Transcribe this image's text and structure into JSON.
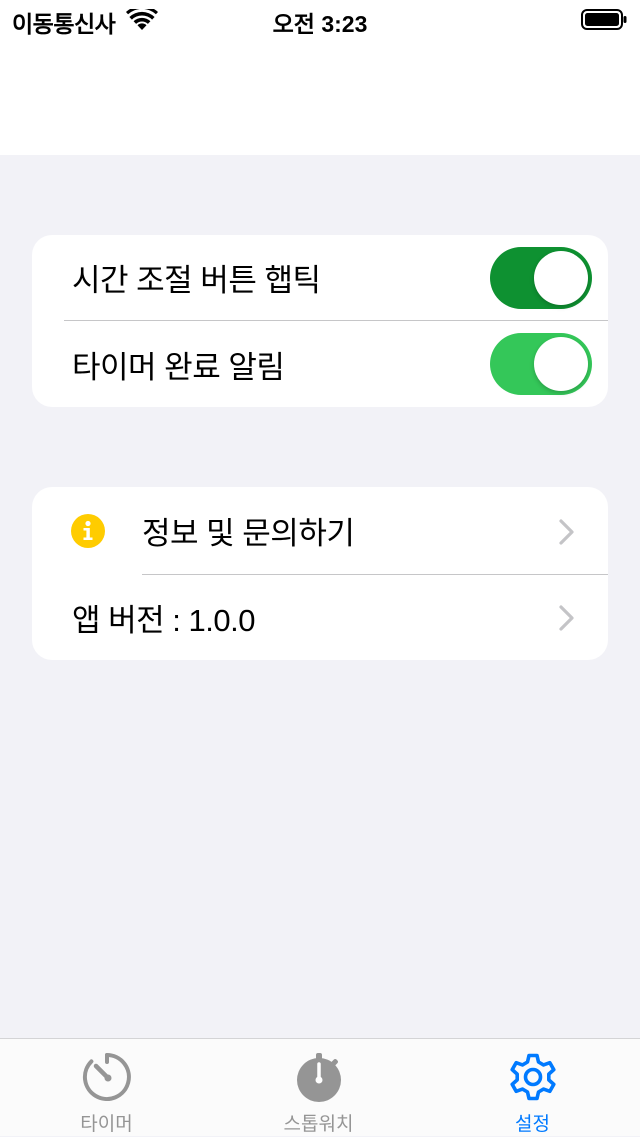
{
  "status_bar": {
    "carrier": "이동통신사",
    "time": "오전 3:23"
  },
  "settings": {
    "toggles": [
      {
        "label": "시간 조절 버튼 햅틱",
        "on": true,
        "color": "#0e9131"
      },
      {
        "label": "타이머 완료 알림",
        "on": true,
        "color": "#34c759"
      }
    ],
    "links": [
      {
        "label": "정보 및 문의하기",
        "icon": "info-icon",
        "icon_color": "#ffcc00"
      },
      {
        "label": "앱 버전 : 1.0.0"
      }
    ]
  },
  "tab_bar": {
    "tabs": [
      {
        "label": "타이머",
        "icon": "timer-icon",
        "active": false
      },
      {
        "label": "스톱워치",
        "icon": "stopwatch-icon",
        "active": false
      },
      {
        "label": "설정",
        "icon": "gear-icon",
        "active": true
      }
    ]
  },
  "colors": {
    "active_tab": "#007aff",
    "inactive_tab": "#959595",
    "chevron": "#c4c4c7",
    "background": "#f2f2f7"
  }
}
